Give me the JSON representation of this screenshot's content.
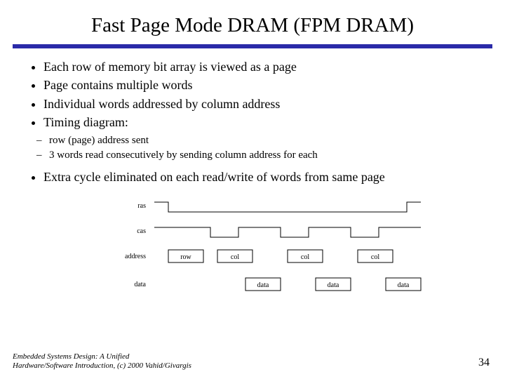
{
  "title": "Fast Page Mode DRAM (FPM DRAM)",
  "bullets": {
    "b1": "Each row of memory bit array is viewed as a page",
    "b2": "Page contains multiple words",
    "b3": "Individual words addressed by column address",
    "b4": "Timing diagram:",
    "s1": "row (page) address sent",
    "s2": "3 words read consecutively by sending column address for each",
    "b5": "Extra cycle eliminated on each read/write of words from same page"
  },
  "timing": {
    "ras": "ras",
    "cas": "cas",
    "address": "address",
    "data": "data",
    "row": "row",
    "col": "col",
    "dataval": "data"
  },
  "footer": {
    "line1": "Embedded Systems Design: A Unified",
    "line2": "Hardware/Software Introduction, (c) 2000 Vahid/Givargis"
  },
  "page_number": "34"
}
